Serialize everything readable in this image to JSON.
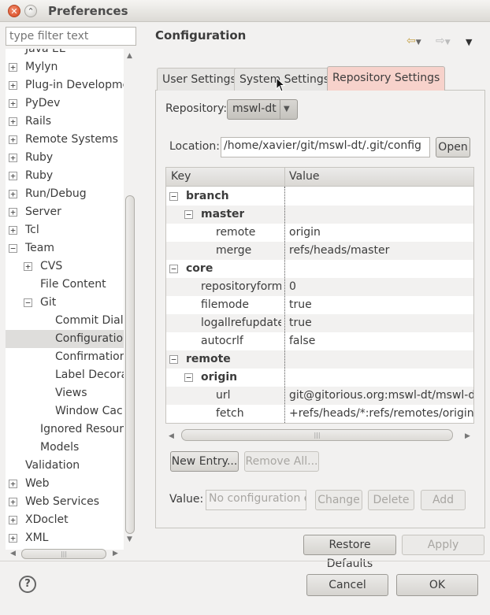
{
  "window": {
    "title": "Preferences"
  },
  "filter": {
    "placeholder": "type filter text"
  },
  "tree": {
    "items": [
      {
        "label": "Java EE",
        "expander": "",
        "indent": 0
      },
      {
        "label": "Mylyn",
        "expander": "+",
        "indent": 0
      },
      {
        "label": "Plug-in Developme",
        "expander": "+",
        "indent": 0
      },
      {
        "label": "PyDev",
        "expander": "+",
        "indent": 0
      },
      {
        "label": "Rails",
        "expander": "+",
        "indent": 0
      },
      {
        "label": "Remote Systems",
        "expander": "+",
        "indent": 0
      },
      {
        "label": "Ruby",
        "expander": "+",
        "indent": 0
      },
      {
        "label": "Ruby",
        "expander": "+",
        "indent": 0
      },
      {
        "label": "Run/Debug",
        "expander": "+",
        "indent": 0
      },
      {
        "label": "Server",
        "expander": "+",
        "indent": 0
      },
      {
        "label": "Tcl",
        "expander": "+",
        "indent": 0
      },
      {
        "label": "Team",
        "expander": "−",
        "indent": 0
      },
      {
        "label": "CVS",
        "expander": "+",
        "indent": 1
      },
      {
        "label": "File Content",
        "expander": "",
        "indent": 1
      },
      {
        "label": "Git",
        "expander": "−",
        "indent": 1
      },
      {
        "label": "Commit Dialo",
        "expander": "",
        "indent": 2
      },
      {
        "label": "Configuration",
        "expander": "",
        "indent": 2,
        "selected": true
      },
      {
        "label": "Confirmation",
        "expander": "",
        "indent": 2
      },
      {
        "label": "Label Decorat",
        "expander": "",
        "indent": 2
      },
      {
        "label": "Views",
        "expander": "",
        "indent": 2
      },
      {
        "label": "Window Cach",
        "expander": "",
        "indent": 2
      },
      {
        "label": "Ignored Resource",
        "expander": "",
        "indent": 1
      },
      {
        "label": "Models",
        "expander": "",
        "indent": 1
      },
      {
        "label": "Validation",
        "expander": "",
        "indent": 0
      },
      {
        "label": "Web",
        "expander": "+",
        "indent": 0
      },
      {
        "label": "Web Services",
        "expander": "+",
        "indent": 0
      },
      {
        "label": "XDoclet",
        "expander": "+",
        "indent": 0
      },
      {
        "label": "XML",
        "expander": "+",
        "indent": 0
      }
    ]
  },
  "page": {
    "title": "Configuration"
  },
  "tabs": {
    "user": "User Settings",
    "system": "System Settings",
    "repository": "Repository Settings"
  },
  "repository": {
    "label": "Repository:",
    "value": "mswl-dt"
  },
  "location": {
    "label": "Location:",
    "value": "/home/xavier/git/mswl-dt/.git/config",
    "open_button": "Open"
  },
  "grid": {
    "headers": {
      "key": "Key",
      "value": "Value"
    },
    "rows": [
      {
        "key": "branch",
        "value": "",
        "level": 0,
        "expander": "−",
        "bold": true
      },
      {
        "key": "master",
        "value": "",
        "level": 1,
        "expander": "−",
        "bold": true
      },
      {
        "key": "remote",
        "value": "origin",
        "level": 2,
        "expander": "",
        "bold": false
      },
      {
        "key": "merge",
        "value": "refs/heads/master",
        "level": 2,
        "expander": "",
        "bold": false
      },
      {
        "key": "core",
        "value": "",
        "level": 0,
        "expander": "−",
        "bold": true
      },
      {
        "key": "repositoryforma",
        "value": "0",
        "level": 1,
        "expander": "",
        "bold": false
      },
      {
        "key": "filemode",
        "value": "true",
        "level": 1,
        "expander": "",
        "bold": false
      },
      {
        "key": "logallrefupdates",
        "value": "true",
        "level": 1,
        "expander": "",
        "bold": false
      },
      {
        "key": "autocrlf",
        "value": "false",
        "level": 1,
        "expander": "",
        "bold": false
      },
      {
        "key": "remote",
        "value": "",
        "level": 0,
        "expander": "−",
        "bold": true
      },
      {
        "key": "origin",
        "value": "",
        "level": 1,
        "expander": "−",
        "bold": true
      },
      {
        "key": "url",
        "value": "git@gitorious.org:mswl-dt/mswl-dt.g",
        "level": 2,
        "expander": "",
        "bold": false
      },
      {
        "key": "fetch",
        "value": "+refs/heads/*:refs/remotes/origin/*",
        "level": 2,
        "expander": "",
        "bold": false
      }
    ]
  },
  "buttons": {
    "new_entry": "New Entry...",
    "remove_all": "Remove All...",
    "change": "Change",
    "delete": "Delete",
    "add": "Add",
    "restore_defaults": "Restore Defaults",
    "apply": "Apply",
    "cancel": "Cancel",
    "ok": "OK"
  },
  "value_field": {
    "label": "Value:",
    "placeholder": "No configuration en"
  },
  "icons": {
    "back": "back-arrow-icon",
    "forward": "forward-arrow-icon",
    "menu": "view-menu-icon",
    "help": "help-icon"
  },
  "colors": {
    "selected_tab": "#f7d2cb",
    "selection": "#dedddb"
  }
}
